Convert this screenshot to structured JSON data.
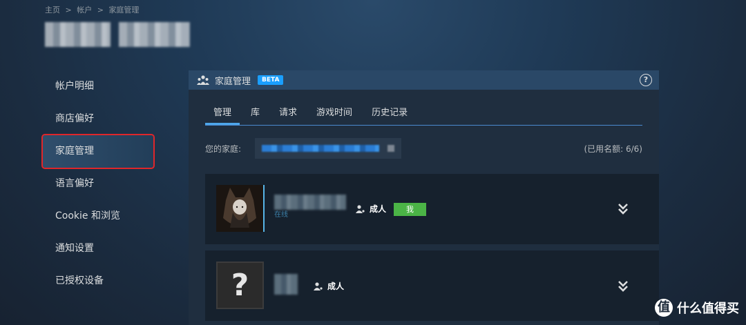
{
  "breadcrumb": [
    "主页",
    ">",
    "帐户",
    ">",
    "家庭管理"
  ],
  "sidebar": {
    "items": [
      {
        "label": "帐户明细"
      },
      {
        "label": "商店偏好"
      },
      {
        "label": "家庭管理"
      },
      {
        "label": "语言偏好"
      },
      {
        "label": "Cookie 和浏览"
      },
      {
        "label": "通知设置"
      },
      {
        "label": "已授权设备"
      }
    ]
  },
  "panel": {
    "title": "家庭管理",
    "badge": "BETA",
    "help": "?"
  },
  "tabs": [
    {
      "label": "管理"
    },
    {
      "label": "库"
    },
    {
      "label": "请求"
    },
    {
      "label": "游戏时间"
    },
    {
      "label": "历史记录"
    }
  ],
  "family": {
    "label": "您的家庭:",
    "quota": "(已用名额: 6/6)"
  },
  "members": [
    {
      "status": "在线",
      "role": "成人",
      "badge": "我"
    },
    {
      "role": "成人",
      "avatar_glyph": "?"
    }
  ],
  "watermark": {
    "logo": "值",
    "text": "什么值得买"
  },
  "colors": {
    "accent": "#1a9fff",
    "me_badge": "#4bb446",
    "active_outline": "#e0262a",
    "tab_underline": "#4ea6ea"
  }
}
